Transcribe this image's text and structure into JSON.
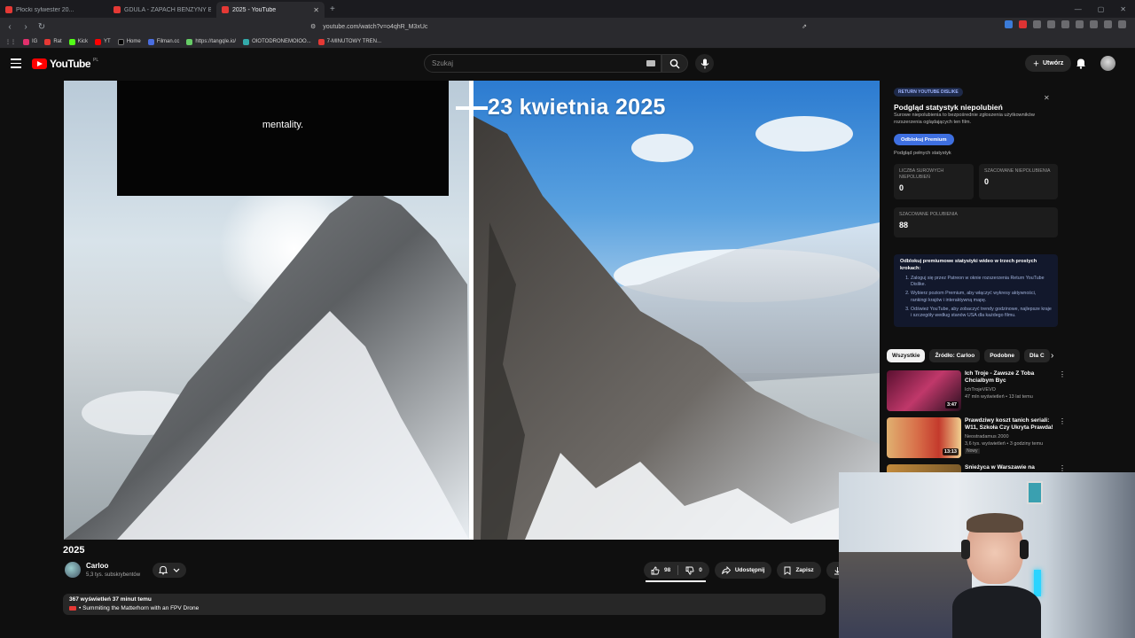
{
  "browser": {
    "tabs": [
      {
        "label": "Płocki sylwester 20...",
        "active": false
      },
      {
        "label": "GDULA - ZAPACH BENZYNY Badm...",
        "active": false
      },
      {
        "label": "2025 - YouTube",
        "active": true
      }
    ],
    "new_tab_glyph": "+",
    "url": "youtube.com/watch?v=o4qhR_M3xUc",
    "bookmarks": [
      "IG",
      "Rat",
      "Kick",
      "YT",
      "Home",
      "Filman.cc",
      "https://tangqle.io/",
      "OIOTODRONEMOIOO...",
      "7-MINUTOWY TREN..."
    ]
  },
  "youtube": {
    "logo_text": "YouTube",
    "logo_region": "PL",
    "search_placeholder": "Szukaj",
    "create_label": "Utwórz"
  },
  "player": {
    "caption": "mentality.",
    "date_overlay": "23 kwietnia 2025"
  },
  "video": {
    "title": "2025",
    "channel_name": "Carloo",
    "channel_subs": "5,3 tys. subskrybentów",
    "likes": "98",
    "dislikes": "0",
    "share_label": "Udostępnij",
    "save_label": "Zapisz",
    "download_label": "Po",
    "stats": "367 wyświetleń  37 minut temu",
    "desc_line": "• Summiting the Matterhorn with an FPV Drone"
  },
  "ryd": {
    "badge": "RETURN YOUTUBE DISLIKE",
    "title": "Podgląd statystyk niepolubień",
    "description": "Surowe niepolubienia to bezpośrednie zgłoszenia użytkowników rozszerzenia oglądających ten film.",
    "button": "Odblokuj Premium",
    "link": "Podgląd pełnych statystyk",
    "stats": [
      {
        "label": "LICZBA SUROWYCH NIEPOLUBIEŃ",
        "value": "0"
      },
      {
        "label": "SZACOWANE NIEPOLUBIENIA",
        "value": "0"
      },
      {
        "label": "SZACOWANE POLUBIENIA",
        "value": "88"
      }
    ],
    "promo_title": "Odblokuj premiumowe statystyki wideo w trzech prostych krokach:",
    "promo_steps": [
      "Zaloguj się przez Patreon w oknie rozszerzenia Return YouTube Dislike.",
      "Wybierz poziom Premium, aby włączyć wykresy aktywności, rankingi krajów i interaktywną mapę.",
      "Odśwież YouTube, aby zobaczyć trendy godzinowe, najlepsze kraje i szczegóły według stanów USA dla każdego filmu."
    ]
  },
  "chips": [
    "Wszystkie",
    "Źródło: Carloo",
    "Podobne",
    "Dla C"
  ],
  "recommendations": [
    {
      "title": "Ich Troje - Zawsze Z Toba Chcialbym Byc",
      "channel": "IchTrojeVEVO",
      "meta": "47 mln wyświetleń • 13 lat temu",
      "duration": "3:47",
      "badge": "",
      "thumb_colors": [
        "#8b1f4a",
        "#e05a8a"
      ]
    },
    {
      "title": "Prawdziwy koszt tanich seriali: W11, Szkoła Czy Ukryta Prawda!",
      "channel": "Neostradamus 2000",
      "meta": "3,6 tys. wyświetleń • 3 godziny temu",
      "duration": "13:13",
      "badge": "Nowy",
      "thumb_colors": [
        "#d9a23a",
        "#c9452d"
      ]
    },
    {
      "title": "Śnieżyca w Warszawie na",
      "channel": "",
      "meta": "",
      "duration": "",
      "badge": "",
      "thumb_colors": [
        "#c28a3c",
        "#7a5a2a"
      ]
    }
  ],
  "icons": {
    "menu": "hamburger-icon",
    "search": "search-icon",
    "mic": "mic-icon",
    "bell": "bell-icon",
    "like": "thumbs-up-icon",
    "dislike": "thumbs-down-icon",
    "share": "share-icon",
    "save": "bookmark-icon",
    "download": "download-icon"
  },
  "colors": {
    "yt_red": "#ff0000",
    "ryd_button": "#3e6fe0",
    "background": "#0f0f0f"
  }
}
